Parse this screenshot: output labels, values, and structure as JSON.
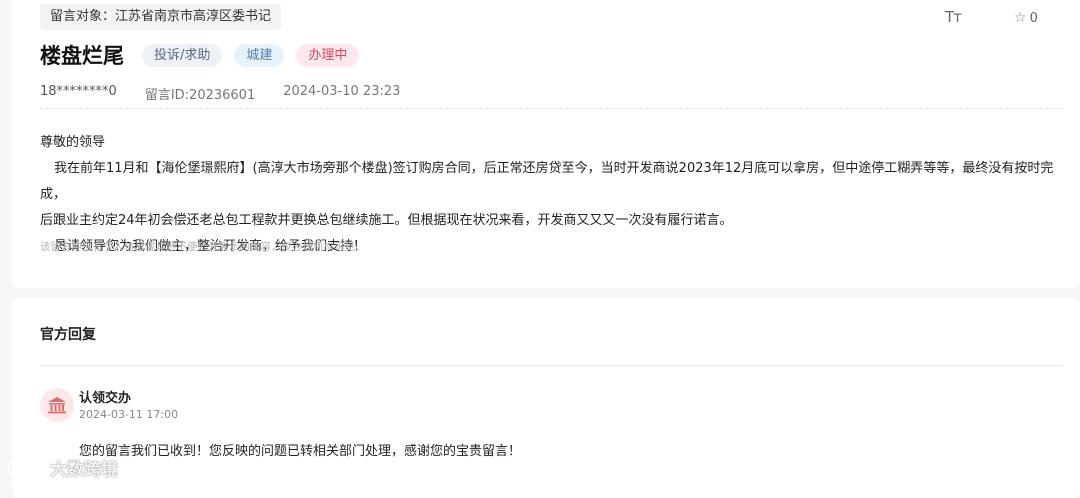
{
  "header": {
    "target_label": "留言对象：江苏省南京市高淳区委书记",
    "font_size_icon": "font-size-icon",
    "star_count": "0"
  },
  "post": {
    "title": "楼盘烂尾",
    "tags": [
      "投诉/求助",
      "城建",
      "办理中"
    ],
    "tag_colors": {
      "type_bg": "#eef1f6",
      "category_bg": "#e8f2fb",
      "status_bg": "#fde9ec",
      "status_text": "#e0435a"
    },
    "user": "18********0",
    "message_id": "留言ID:20236601",
    "datetime": "2024-03-10 23:23",
    "content": {
      "salutation": "尊敬的领导",
      "paragraph1": "我在前年11月和【海伦堡璟熙府】(高淳大市场旁那个楼盘)签订购房合同，后正常还房贷至今，当时开发商说2023年12月底可以拿房，但中途停工糊弄等等，最终没有按时完成，",
      "paragraph1_cont": "后跟业主约定24年初会偿还老总包工程款并更换总包继续施工。但根据现在状况来看，开发商又又又一次没有履行诺言。",
      "paragraph2": "恳请领导您为我们做主，整治开发商，给予我们支持！"
    },
    "privacy_note": "该留言中含有个人信息或其他不便公开展示的内容，仅办理机构可见。"
  },
  "reply": {
    "heading": "官方回复",
    "org_icon": "government-building-icon",
    "org_name": "认领交办",
    "time": "2024-03-11 17:00",
    "text": "您的留言我们已收到！您反映的问题已转相关部门处理，感谢您的宝贵留言！"
  },
  "watermark": {
    "text": "大数跨境"
  }
}
